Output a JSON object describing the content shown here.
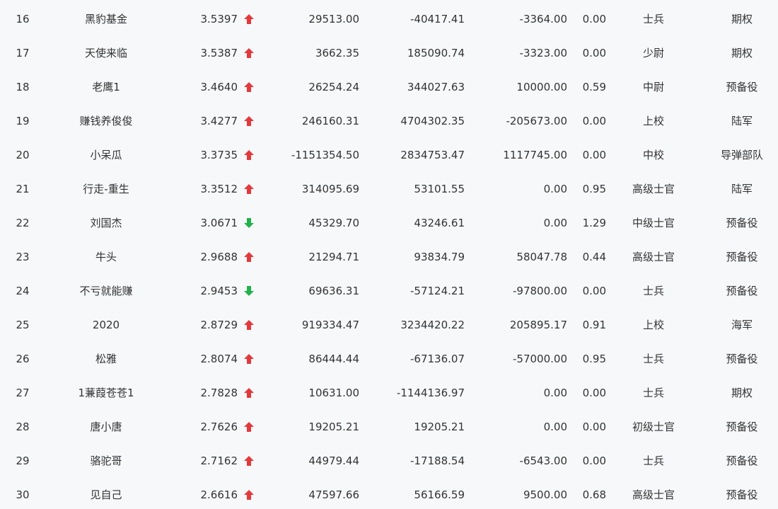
{
  "colors": {
    "background": "#f7f8fa",
    "text": "#333333",
    "up": "#e4393c",
    "down": "#22b14c"
  },
  "rows": [
    {
      "rank": "16",
      "name": "黑豹基金",
      "score": "3.5397",
      "trend": "up",
      "a": "29513.00",
      "b": "-40417.41",
      "c": "-3364.00",
      "d": "0.00",
      "title": "士兵",
      "group": "期权"
    },
    {
      "rank": "17",
      "name": "天使来临",
      "score": "3.5387",
      "trend": "up",
      "a": "3662.35",
      "b": "185090.74",
      "c": "-3323.00",
      "d": "0.00",
      "title": "少尉",
      "group": "期权"
    },
    {
      "rank": "18",
      "name": "老鹰1",
      "score": "3.4640",
      "trend": "up",
      "a": "26254.24",
      "b": "344027.63",
      "c": "10000.00",
      "d": "0.59",
      "title": "中尉",
      "group": "预备役"
    },
    {
      "rank": "19",
      "name": "赚钱养俊俊",
      "score": "3.4277",
      "trend": "up",
      "a": "246160.31",
      "b": "4704302.35",
      "c": "-205673.00",
      "d": "0.00",
      "title": "上校",
      "group": "陆军"
    },
    {
      "rank": "20",
      "name": "小呆瓜",
      "score": "3.3735",
      "trend": "up",
      "a": "-1151354.50",
      "b": "2834753.47",
      "c": "1117745.00",
      "d": "0.00",
      "title": "中校",
      "group": "导弹部队"
    },
    {
      "rank": "21",
      "name": "行走-重生",
      "score": "3.3512",
      "trend": "up",
      "a": "314095.69",
      "b": "53101.55",
      "c": "0.00",
      "d": "0.95",
      "title": "高级士官",
      "group": "陆军"
    },
    {
      "rank": "22",
      "name": "刘国杰",
      "score": "3.0671",
      "trend": "down",
      "a": "45329.70",
      "b": "43246.61",
      "c": "0.00",
      "d": "1.29",
      "title": "中级士官",
      "group": "预备役"
    },
    {
      "rank": "23",
      "name": "牛头",
      "score": "2.9688",
      "trend": "up",
      "a": "21294.71",
      "b": "93834.79",
      "c": "58047.78",
      "d": "0.44",
      "title": "高级士官",
      "group": "预备役"
    },
    {
      "rank": "24",
      "name": "不亏就能赚",
      "score": "2.9453",
      "trend": "down",
      "a": "69636.31",
      "b": "-57124.21",
      "c": "-97800.00",
      "d": "0.00",
      "title": "士兵",
      "group": "预备役"
    },
    {
      "rank": "25",
      "name": "2020",
      "score": "2.8729",
      "trend": "up",
      "a": "919334.47",
      "b": "3234420.22",
      "c": "205895.17",
      "d": "0.91",
      "title": "上校",
      "group": "海军"
    },
    {
      "rank": "26",
      "name": "松雅",
      "score": "2.8074",
      "trend": "up",
      "a": "86444.44",
      "b": "-67136.07",
      "c": "-57000.00",
      "d": "0.95",
      "title": "士兵",
      "group": "预备役"
    },
    {
      "rank": "27",
      "name": "1蒹葭苍苍1",
      "score": "2.7828",
      "trend": "up",
      "a": "10631.00",
      "b": "-1144136.97",
      "c": "0.00",
      "d": "0.00",
      "title": "士兵",
      "group": "期权"
    },
    {
      "rank": "28",
      "name": "唐小唐",
      "score": "2.7626",
      "trend": "up",
      "a": "19205.21",
      "b": "19205.21",
      "c": "0.00",
      "d": "0.00",
      "title": "初级士官",
      "group": "预备役"
    },
    {
      "rank": "29",
      "name": "骆驼哥",
      "score": "2.7162",
      "trend": "up",
      "a": "44979.44",
      "b": "-17188.54",
      "c": "-6543.00",
      "d": "0.00",
      "title": "士兵",
      "group": "预备役"
    },
    {
      "rank": "30",
      "name": "见自己",
      "score": "2.6616",
      "trend": "up",
      "a": "47597.66",
      "b": "56166.59",
      "c": "9500.00",
      "d": "0.68",
      "title": "高级士官",
      "group": "预备役"
    }
  ]
}
